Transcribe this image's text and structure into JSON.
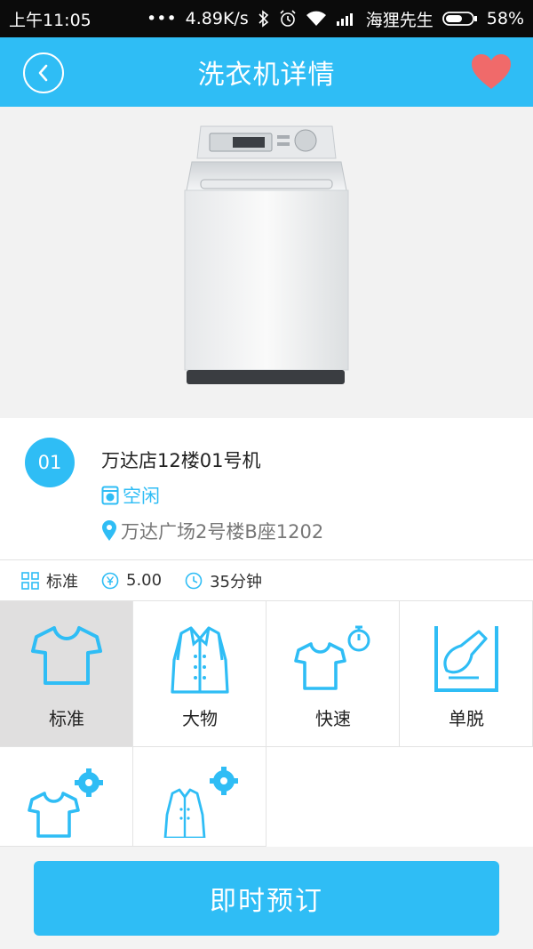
{
  "status_bar": {
    "time": "上午11:05",
    "speed": "4.89K/s",
    "carrier": "海狸先生",
    "battery": "58%"
  },
  "header": {
    "title": "洗衣机详情",
    "favorite_color": "#f06a6a"
  },
  "machine": {
    "number": "01",
    "name": "万达店12楼01号机",
    "status": "空闲",
    "address": "万达广场2号楼B座1202"
  },
  "summary": {
    "mode": "标准",
    "price": "5.00",
    "duration": "35分钟"
  },
  "modes": [
    {
      "label": "标准",
      "icon": "tshirt-icon",
      "selected": true
    },
    {
      "label": "大物",
      "icon": "coat-icon",
      "selected": false
    },
    {
      "label": "快速",
      "icon": "tshirt-stopwatch-icon",
      "selected": false
    },
    {
      "label": "单脱",
      "icon": "spin-dry-icon",
      "selected": false
    },
    {
      "label": "",
      "icon": "tshirt-gear-icon",
      "selected": false
    },
    {
      "label": "",
      "icon": "coat-gear-icon",
      "selected": false
    }
  ],
  "actions": {
    "book_label": "即时预订"
  },
  "colors": {
    "accent": "#2fbdf5",
    "selected_bg": "#e0dfdf"
  }
}
